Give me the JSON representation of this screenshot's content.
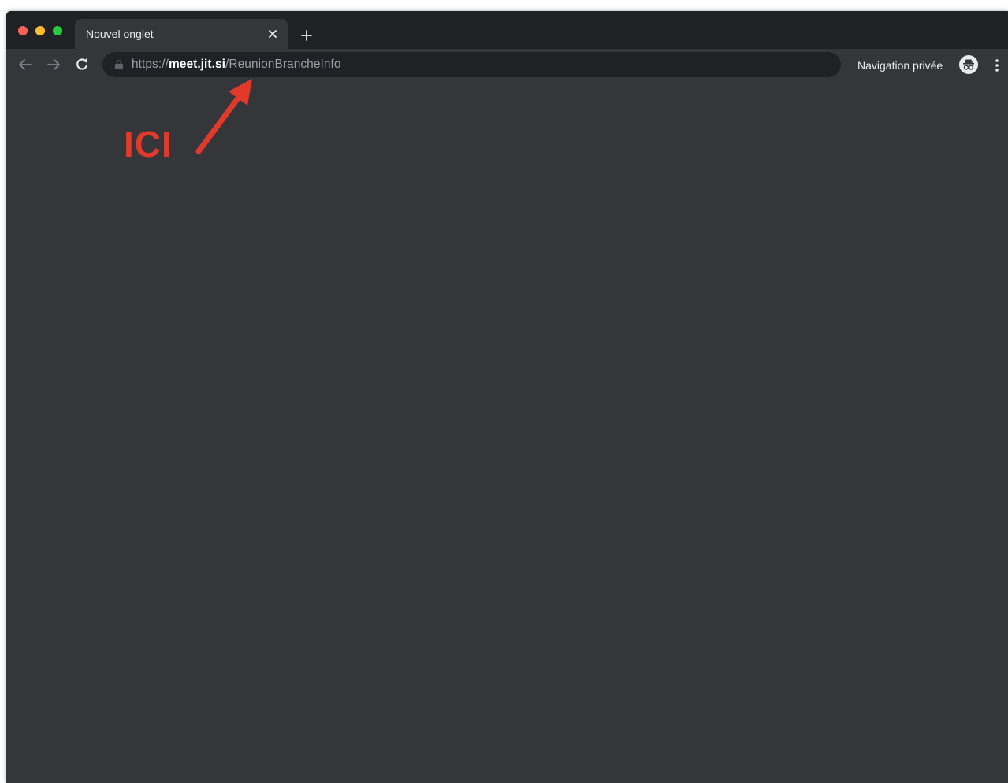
{
  "browser": {
    "tab": {
      "title": "Nouvel onglet",
      "close_icon": "close-icon"
    },
    "new_tab_icon": "plus-icon",
    "toolbar": {
      "back_icon": "arrow-left-icon",
      "forward_icon": "arrow-right-icon",
      "reload_icon": "reload-icon"
    },
    "omnibox": {
      "scheme": "https://",
      "host": "meet.jit.si",
      "path": "/ReunionBrancheInfo"
    },
    "incognito": {
      "label": "Navigation privée",
      "icon": "incognito-icon"
    },
    "menu_icon": "three-dots-vertical-icon"
  },
  "annotation": {
    "text": "ICI",
    "color": "#e13a2a"
  },
  "colors": {
    "tabstrip": "#202124",
    "toolbar": "#35363a",
    "omnibox": "#202124",
    "content": "#35363a"
  }
}
